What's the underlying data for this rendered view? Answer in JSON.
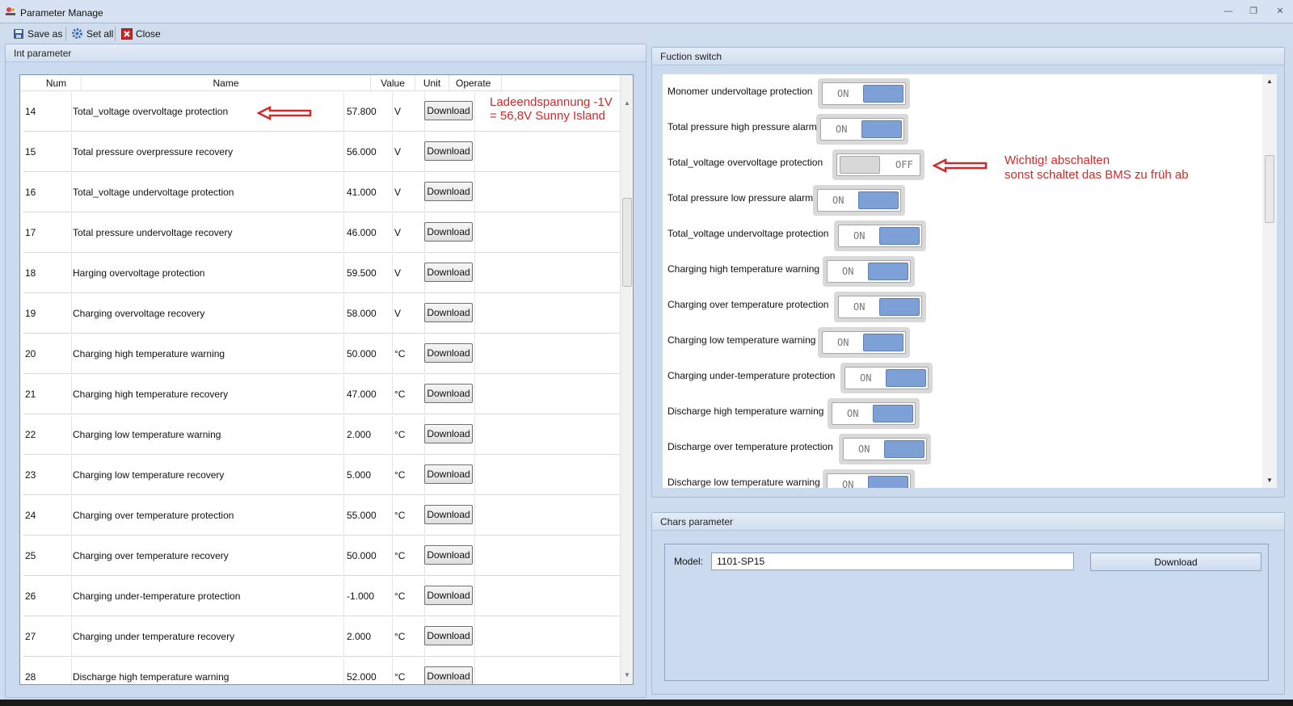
{
  "window": {
    "title": "Parameter Manage"
  },
  "toolbar": {
    "save_as": "Save as",
    "set_all": "Set all",
    "close": "Close"
  },
  "int_parameter": {
    "title": "Int parameter",
    "columns": {
      "num": "Num",
      "name": "Name",
      "value": "Value",
      "unit": "Unit",
      "operate": "Operate"
    },
    "rows": [
      {
        "num": "14",
        "name": "Total_voltage overvoltage protection",
        "value": "57.800",
        "unit": "V",
        "button": "Download"
      },
      {
        "num": "15",
        "name": "Total pressure overpressure recovery",
        "value": "56.000",
        "unit": "V",
        "button": "Download"
      },
      {
        "num": "16",
        "name": "Total_voltage undervoltage protection",
        "value": "41.000",
        "unit": "V",
        "button": "Download"
      },
      {
        "num": "17",
        "name": "Total pressure undervoltage recovery",
        "value": "46.000",
        "unit": "V",
        "button": "Download"
      },
      {
        "num": "18",
        "name": "Harging overvoltage protection",
        "value": "59.500",
        "unit": "V",
        "button": "Download"
      },
      {
        "num": "19",
        "name": "Charging overvoltage recovery",
        "value": "58.000",
        "unit": "V",
        "button": "Download"
      },
      {
        "num": "20",
        "name": "Charging high temperature warning",
        "value": "50.000",
        "unit": "°C",
        "button": "Download"
      },
      {
        "num": "21",
        "name": "Charging high temperature recovery",
        "value": "47.000",
        "unit": "°C",
        "button": "Download"
      },
      {
        "num": "22",
        "name": "Charging low temperature warning",
        "value": "2.000",
        "unit": "°C",
        "button": "Download"
      },
      {
        "num": "23",
        "name": "Charging low temperature recovery",
        "value": "5.000",
        "unit": "°C",
        "button": "Download"
      },
      {
        "num": "24",
        "name": "Charging over temperature protection",
        "value": "55.000",
        "unit": "°C",
        "button": "Download"
      },
      {
        "num": "25",
        "name": "Charging over temperature recovery",
        "value": "50.000",
        "unit": "°C",
        "button": "Download"
      },
      {
        "num": "26",
        "name": "Charging under-temperature protection",
        "value": "-1.000",
        "unit": "°C",
        "button": "Download"
      },
      {
        "num": "27",
        "name": "Charging under temperature recovery",
        "value": "2.000",
        "unit": "°C",
        "button": "Download"
      },
      {
        "num": "28",
        "name": "Discharge high temperature warning",
        "value": "52.000",
        "unit": "°C",
        "button": "Download"
      }
    ]
  },
  "annotations": {
    "left_line1": "Ladeendspannung -1V",
    "left_line2": "= 56,8V Sunny Island",
    "right_line1": "Wichtig! abschalten",
    "right_line2": "sonst schaltet das BMS zu früh ab",
    "color": "#d02a2a"
  },
  "function_switch": {
    "title": "Fuction switch",
    "items": [
      {
        "label": "Monomer undervoltage protection",
        "state": "ON"
      },
      {
        "label": "Total pressure high pressure alarm",
        "state": "ON"
      },
      {
        "label": "Total_voltage overvoltage protection",
        "state": "OFF"
      },
      {
        "label": "Total pressure low pressure alarm",
        "state": "ON"
      },
      {
        "label": "Total_voltage undervoltage protection",
        "state": "ON"
      },
      {
        "label": "Charging high temperature warning",
        "state": "ON"
      },
      {
        "label": "Charging over temperature protection",
        "state": "ON"
      },
      {
        "label": "Charging low temperature warning",
        "state": "ON"
      },
      {
        "label": "Charging under-temperature protection",
        "state": "ON"
      },
      {
        "label": "Discharge high temperature warning",
        "state": "ON"
      },
      {
        "label": "Discharge over temperature protection",
        "state": "ON"
      },
      {
        "label": "Discharge low temperature warning",
        "state": "ON"
      }
    ],
    "on_color": "#7da1d6"
  },
  "chars_parameter": {
    "title": "Chars parameter",
    "model_label": "Model:",
    "model_value": "1101-SP15",
    "download": "Download"
  }
}
